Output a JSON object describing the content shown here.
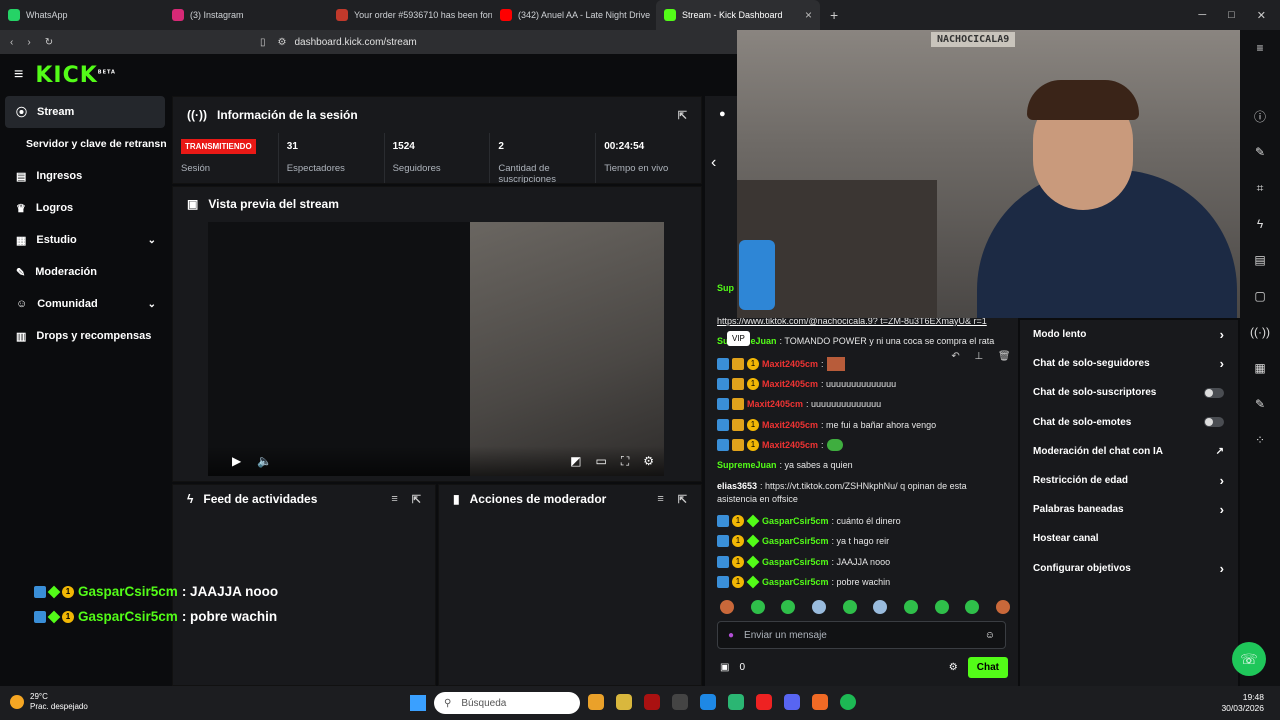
{
  "browser": {
    "tabs": [
      {
        "label": "WhatsApp",
        "color": "#25d366"
      },
      {
        "label": "(3) Instagram",
        "color": "#d62976"
      },
      {
        "label": "Your order #5936710 has been forme",
        "color": "#c0392b"
      },
      {
        "label": "(342) Anuel AA - Late Night Drive",
        "color": "#ff0000"
      },
      {
        "label": "Stream - Kick Dashboard",
        "color": "#53fc18"
      }
    ],
    "url": "dashboard.kick.com/stream"
  },
  "brand": {
    "logo": "KICK",
    "tag": "BETA",
    "accent": "#53fc18"
  },
  "sidebar": {
    "items": [
      {
        "label": "Stream",
        "icon": "broadcast-icon"
      },
      {
        "label": "Servidor y clave de retransn",
        "icon": ""
      },
      {
        "label": "Ingresos",
        "icon": "chart-icon"
      },
      {
        "label": "Logros",
        "icon": "trophy-icon"
      },
      {
        "label": "Estudio",
        "icon": "studio-icon"
      },
      {
        "label": "Moderación",
        "icon": "wrench-icon"
      },
      {
        "label": "Comunidad",
        "icon": "people-icon"
      },
      {
        "label": "Drops y recompensas",
        "icon": "gift-icon"
      }
    ]
  },
  "session": {
    "title": "Información de la sesión",
    "status": "TRANSMITIENDO",
    "status_label": "Sesión",
    "stats": [
      {
        "value": "31",
        "label": "Espectadores"
      },
      {
        "value": "1524",
        "label": "Seguidores"
      },
      {
        "value": "2",
        "label": "Cantidad de suscripciones"
      },
      {
        "value": "00:24:54",
        "label": "Tiempo en vivo"
      }
    ]
  },
  "preview": {
    "title": "Vista previa del stream"
  },
  "feed": {
    "title": "Feed de actividades"
  },
  "modactions": {
    "title": "Acciones de moderador"
  },
  "overlay_chat": [
    {
      "user": "GasparCsir5cm",
      "text": " : JAAJJA nooo"
    },
    {
      "user": "GasparCsir5cm",
      "text": " : pobre wachin"
    }
  ],
  "chat": {
    "messages": [
      {
        "user": "Sup",
        "text": "",
        "userColor": "#53fc18",
        "badges": 0
      },
      {
        "user": "",
        "text": "https://www.tiktok.com/@nachocicala.9? t=ZM-8u3T6EXmayU& r=1",
        "userColor": "#fff",
        "badges": 0
      },
      {
        "user": "SupremeJuan",
        "text": ": TOMANDO POWER y ni una coca se compra el rata",
        "userColor": "#53fc18",
        "badges": 0
      },
      {
        "user": "Maxit2405cm",
        "text": ":",
        "userColor": "#e33",
        "badges": 3
      },
      {
        "user": "Maxit2405cm",
        "text": ": uuuuuuuuuuuuuu",
        "userColor": "#e33",
        "badges": 3
      },
      {
        "user": "Maxit2405cm",
        "text": ": uuuuuuuuuuuuuu",
        "userColor": "#e33",
        "badges": 2
      },
      {
        "user": "Maxit2405cm",
        "text": ": me fui a bañar ahora vengo",
        "userColor": "#e33",
        "badges": 3
      },
      {
        "user": "Maxit2405cm",
        "text": ":",
        "userColor": "#e33",
        "badges": 3
      },
      {
        "user": "SupremeJuan",
        "text": ": ya sabes a quien",
        "userColor": "#53fc18",
        "badges": 0
      },
      {
        "user": "elias3653",
        "text": ": https://vt.tiktok.com/ZSHNkphNu/ q opinan de esta",
        "userColor": "#fff",
        "badges": 0
      },
      {
        "user": "",
        "text": "asistencia en offsice",
        "userColor": "#fff",
        "badges": 0
      },
      {
        "user": "GasparCsir5cm",
        "text": ": cuánto él dinero",
        "userColor": "#53fc18",
        "badges": 3
      },
      {
        "user": "GasparCsir5cm",
        "text": ": ya t hago reir",
        "userColor": "#53fc18",
        "badges": 3
      },
      {
        "user": "GasparCsir5cm",
        "text": ": JAAJJA nooo",
        "userColor": "#53fc18",
        "badges": 3
      },
      {
        "user": "GasparCsir5cm",
        "text": ": pobre wachin",
        "userColor": "#53fc18",
        "badges": 3
      }
    ],
    "vip_tooltip": "VIP",
    "input_placeholder": "Enviar un mensaje",
    "count": "0",
    "send_label": "Chat"
  },
  "settings": {
    "items": [
      {
        "label": "Modo lento",
        "control": "chevron"
      },
      {
        "label": "Chat de solo-seguidores",
        "control": "chevron"
      },
      {
        "label": "Chat de solo-suscriptores",
        "control": "toggle"
      },
      {
        "label": "Chat de solo-emotes",
        "control": "toggle"
      },
      {
        "label": "Moderación del chat con IA",
        "control": "external"
      },
      {
        "label": "Restricción de edad",
        "control": "chevron"
      },
      {
        "label": "Palabras baneadas",
        "control": "chevron"
      },
      {
        "label": "Hostear canal",
        "control": "none"
      },
      {
        "label": "Configurar objetivos",
        "control": "chevron"
      }
    ]
  },
  "webcam": {
    "wall_text": "NACHOCICALA9"
  },
  "taskbar": {
    "temp": "29°C",
    "weather": "Prac. despejado",
    "search": "Búsqueda",
    "time": "19:48",
    "date": "30/03/2026"
  }
}
